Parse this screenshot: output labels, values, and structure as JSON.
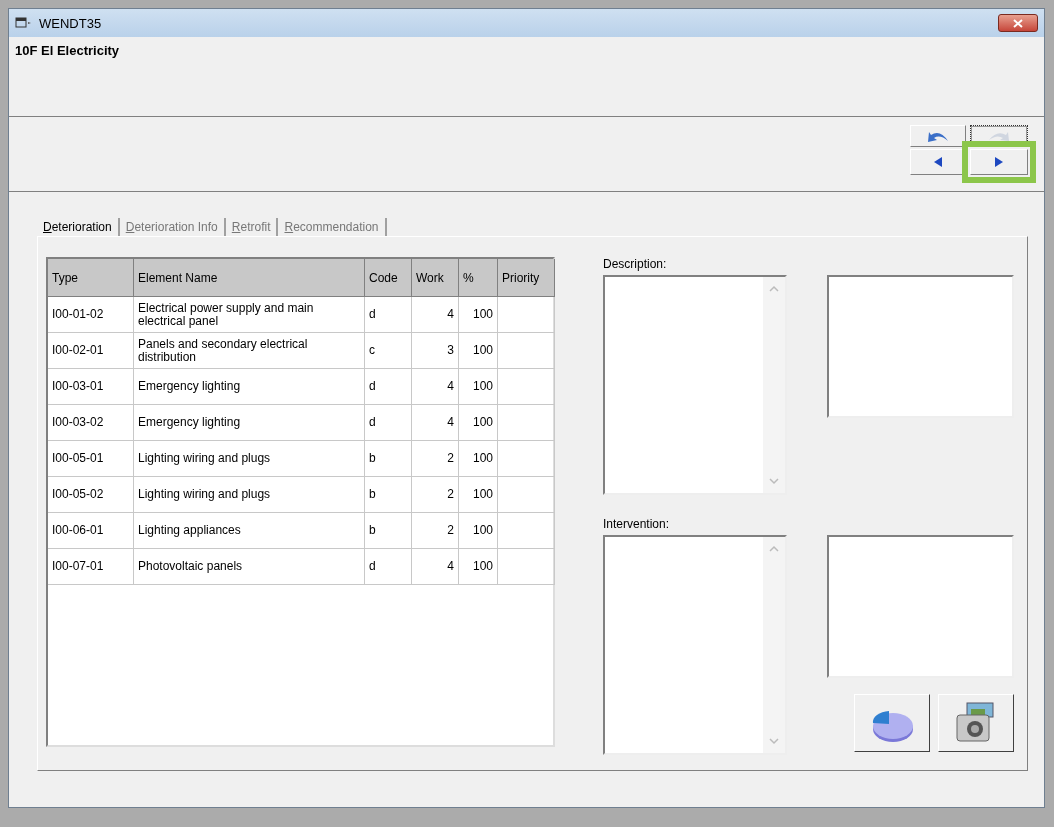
{
  "window": {
    "title": "WENDT35"
  },
  "header": {
    "title": "10F El Electricity"
  },
  "nav_buttons": [
    {
      "kind": "undo",
      "highlighted": false
    },
    {
      "kind": "redo",
      "highlighted": false
    },
    {
      "kind": "prev",
      "highlighted": false
    },
    {
      "kind": "next",
      "highlighted": true
    }
  ],
  "tabs": [
    {
      "label": "Deterioration",
      "selected": true
    },
    {
      "label": "Deterioration Info",
      "selected": false
    },
    {
      "label": "Retrofit",
      "selected": false
    },
    {
      "label": "Recommendation",
      "selected": false
    }
  ],
  "table": {
    "columns": [
      "Type",
      "Element Name",
      "Code",
      "Work",
      "%",
      "Priority"
    ],
    "rows": [
      {
        "cells": [
          "I00-01-02",
          "Electrical power supply and main electrical panel",
          "d",
          "4",
          "100"
        ]
      },
      {
        "cells": [
          "I00-02-01",
          "Panels and secondary electrical distribution",
          "c",
          "3",
          "100"
        ]
      },
      {
        "cells": [
          "I00-03-01",
          "Emergency lighting",
          "d",
          "4",
          "100"
        ]
      },
      {
        "cells": [
          "I00-03-02",
          "Emergency lighting",
          "d",
          "4",
          "100"
        ]
      },
      {
        "cells": [
          "I00-05-01",
          "Lighting wiring and plugs",
          "b",
          "2",
          "100"
        ]
      },
      {
        "cells": [
          "I00-05-02",
          "Lighting wiring and plugs",
          "b",
          "2",
          "100"
        ]
      },
      {
        "cells": [
          "I00-06-01",
          "Lighting appliances",
          "b",
          "2",
          "100"
        ]
      },
      {
        "cells": [
          "I00-07-01",
          "Photovoltaic panels",
          "d",
          "4",
          "100"
        ]
      }
    ]
  },
  "description": {
    "label": "Description:"
  },
  "intervention": {
    "label": "Intervention:"
  },
  "tool_buttons": [
    {
      "kind": "chart"
    },
    {
      "kind": "camera"
    }
  ]
}
